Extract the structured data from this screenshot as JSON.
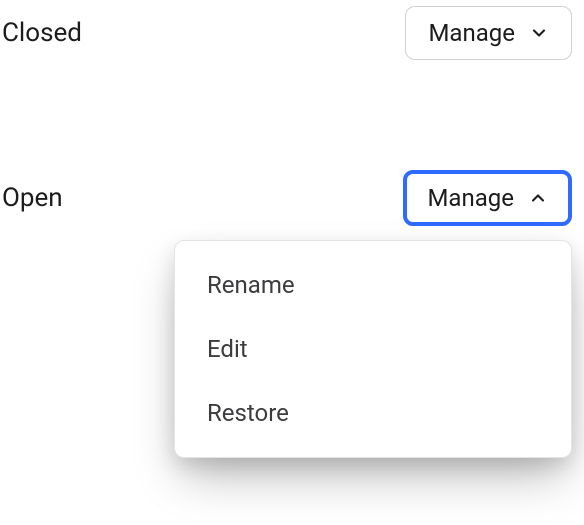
{
  "rows": {
    "closed": {
      "status": "Closed",
      "button_label": "Manage"
    },
    "open": {
      "status": "Open",
      "button_label": "Manage"
    }
  },
  "dropdown": {
    "items": [
      {
        "label": "Rename"
      },
      {
        "label": "Edit"
      },
      {
        "label": "Restore"
      }
    ]
  }
}
